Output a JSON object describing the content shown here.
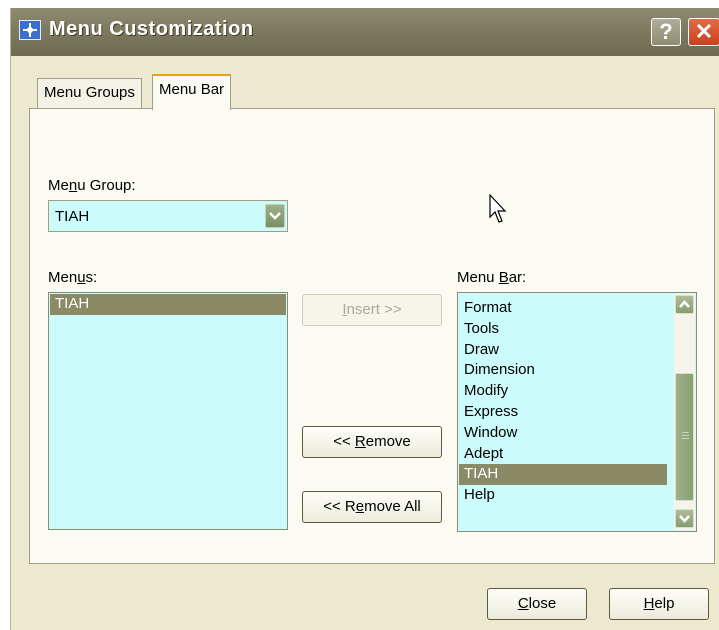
{
  "window": {
    "title": "Menu Customization",
    "help_glyph": "?",
    "close_glyph": "✕"
  },
  "tabs": [
    {
      "label": "Menu Groups",
      "active": false
    },
    {
      "label": "Menu Bar",
      "active": true
    }
  ],
  "menu_group": {
    "label_pre": "Me",
    "label_key": "n",
    "label_post": "u Group:",
    "value": "TIAH"
  },
  "menus": {
    "label_pre": "Men",
    "label_key": "u",
    "label_post": "s:",
    "items": [
      {
        "label": "TIAH",
        "selected": true
      }
    ]
  },
  "menu_bar": {
    "label_pre": "Menu ",
    "label_key": "B",
    "label_post": "ar:",
    "items": [
      {
        "label": "Format",
        "selected": false
      },
      {
        "label": "Tools",
        "selected": false
      },
      {
        "label": "Draw",
        "selected": false
      },
      {
        "label": "Dimension",
        "selected": false
      },
      {
        "label": "Modify",
        "selected": false
      },
      {
        "label": "Express",
        "selected": false
      },
      {
        "label": "Window",
        "selected": false
      },
      {
        "label": "Adept",
        "selected": false
      },
      {
        "label": "TIAH",
        "selected": true
      },
      {
        "label": "Help",
        "selected": false
      }
    ]
  },
  "buttons": {
    "insert": {
      "key": "I",
      "rest": "nsert >>",
      "enabled": false
    },
    "remove": {
      "pre": "<< ",
      "key": "R",
      "rest": "emove",
      "enabled": true
    },
    "remove_all": {
      "pre": "<< R",
      "key": "e",
      "rest": "move All",
      "enabled": true
    },
    "close": {
      "key": "C",
      "rest": "lose"
    },
    "help": {
      "key": "H",
      "rest": "elp"
    }
  },
  "icons": {
    "app": "app-icon",
    "dropdown": "chevron-down-icon",
    "scroll_up": "chevron-up-icon",
    "scroll_down": "chevron-down-icon",
    "cursor": "mouse-pointer-icon"
  },
  "colors": {
    "list_bg": "#ccfbfb",
    "selection": "#8a8a66",
    "titlebar": "#7e7a60",
    "tab_accent": "#e8a020",
    "close_button": "#c8421e"
  }
}
